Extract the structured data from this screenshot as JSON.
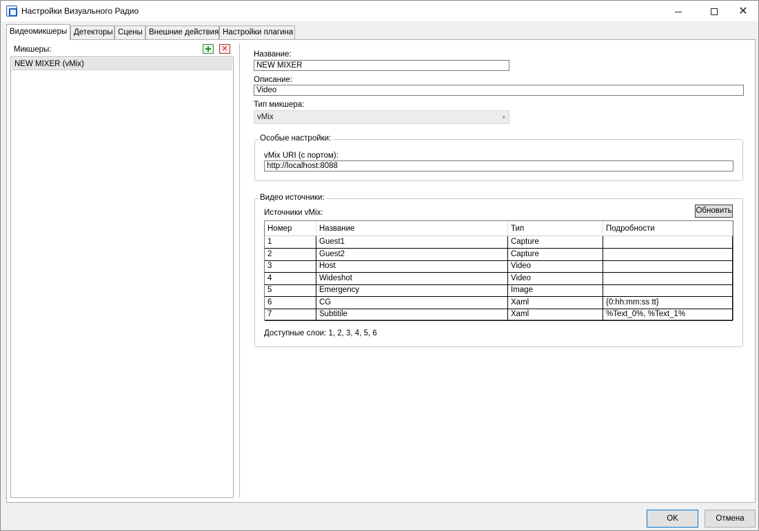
{
  "window": {
    "title": "Настройки Визуального Радио",
    "close_glyph": "✕"
  },
  "tabs": [
    {
      "label": "Видеомикшеры",
      "active": true
    },
    {
      "label": "Детекторы"
    },
    {
      "label": "Сцены"
    },
    {
      "label": "Внешние действия"
    },
    {
      "label": "Настройки плагина"
    }
  ],
  "left": {
    "label": "Микшеры:",
    "delete_glyph": "✕",
    "items": [
      {
        "label": "NEW MIXER (vMix)"
      }
    ]
  },
  "form": {
    "name_label": "Название:",
    "name_value": "NEW MIXER",
    "desc_label": "Описание:",
    "desc_value": "Video",
    "type_label": "Тип микшера:",
    "type_value": "vMix",
    "combo_arrow": "▾"
  },
  "special": {
    "title": "Особые настройки:",
    "uri_label": "vMix URI (с портом):",
    "uri_value": "http://localhost:8088"
  },
  "sources": {
    "title": "Видео источники:",
    "label": "Источники vMix:",
    "refresh": "Обновить",
    "columns": [
      "Номер",
      "Название",
      "Тип",
      "Подробности"
    ],
    "rows": [
      [
        "1",
        "Guest1",
        "Capture",
        ""
      ],
      [
        "2",
        "Guest2",
        "Capture",
        ""
      ],
      [
        "3",
        "Host",
        "Video",
        ""
      ],
      [
        "4",
        "Wideshot",
        "Video",
        ""
      ],
      [
        "5",
        "Emergency",
        "Image",
        ""
      ],
      [
        "6",
        "CG",
        "Xaml",
        "{0:hh:mm:ss tt}"
      ],
      [
        "7",
        "Subtitile",
        "Xaml",
        "%Text_0%, %Text_1%"
      ]
    ],
    "layers": "Доступные слои:   1, 2, 3, 4, 5, 6"
  },
  "buttons": {
    "ok": "OK",
    "cancel": "Отмена"
  }
}
